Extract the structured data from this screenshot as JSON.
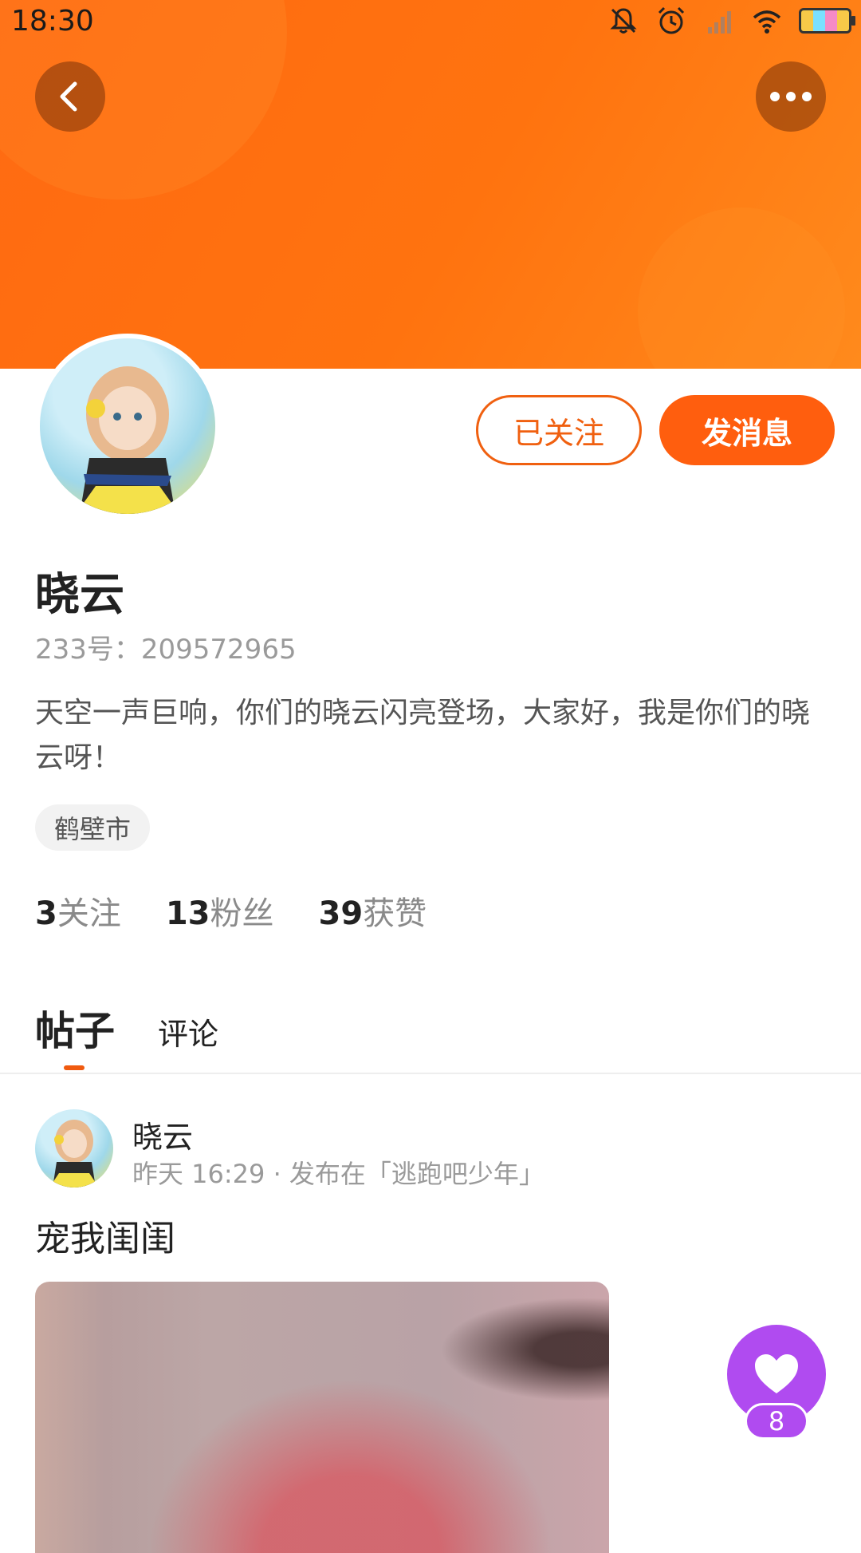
{
  "status_bar": {
    "time": "18:30",
    "icons": [
      "mute-bell-icon",
      "alarm-icon",
      "signal-icon",
      "wifi-icon",
      "battery-icon"
    ]
  },
  "colors": {
    "accent": "#ff5e0e",
    "banner": "#ff730f",
    "like": "#b04bf0"
  },
  "profile": {
    "name": "晓云",
    "id_text": "233号：209572965",
    "bio": "天空一声巨响，你们的晓云闪亮登场，大家好，我是你们的晓云呀！",
    "location": "鹤壁市",
    "followed_label": "已关注",
    "message_label": "发消息",
    "stats": [
      {
        "num": "3",
        "label": "关注"
      },
      {
        "num": "13",
        "label": "粉丝"
      },
      {
        "num": "39",
        "label": "获赞"
      }
    ]
  },
  "tabs": {
    "posts": "帖子",
    "comments": "评论"
  },
  "post": {
    "author": "晓云",
    "meta": "昨天 16:29 · 发布在「逃跑吧少年」",
    "title": "宠我闺闺",
    "like_count": "8"
  }
}
